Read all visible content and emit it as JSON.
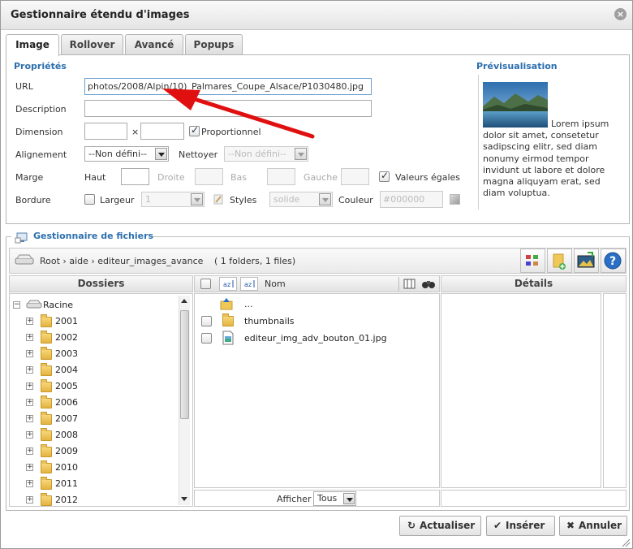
{
  "title": "Gestionnaire étendu d'images",
  "tabs": [
    "Image",
    "Rollover",
    "Avancé",
    "Popups"
  ],
  "props": {
    "section": "Propriétés",
    "url_label": "URL",
    "url_value": "photos/2008/Alpin/10)_Palmares_Coupe_Alsace/P1030480.jpg",
    "description_label": "Description",
    "dimension_label": "Dimension",
    "times": "×",
    "proportional_label": "Proportionnel",
    "alignment_label": "Alignement",
    "alignment_value": "--Non défini--",
    "clear_label": "Nettoyer",
    "clear_value": "--Non défini--",
    "margin_label": "Marge",
    "top_label": "Haut",
    "right_label": "Droite",
    "bottom_label": "Bas",
    "left_label": "Gauche",
    "equal_label": "Valeurs égales",
    "border_label": "Bordure",
    "width_label": "Largeur",
    "width_value": "1",
    "styles_label": "Styles",
    "styles_value": "solide",
    "color_label": "Couleur",
    "color_value": "#000000"
  },
  "preview": {
    "title": "Prévisualisation",
    "text": "Lorem ipsum dolor sit amet, consetetur sadipscing elitr, sed diam nonumy eirmod tempor invidunt ut labore et dolore magna aliquyam erat, sed diam voluptua."
  },
  "files": {
    "legend": "Gestionnaire de fichiers",
    "crumb_root": "Root",
    "crumb_1": "aide",
    "crumb_2": "editeur_images_avance",
    "sep": "›",
    "summary": "( 1 folders, 1 files)",
    "folders_header": "Dossiers",
    "details_header": "Détails",
    "name_col": "Nom",
    "root": "Racine",
    "years": [
      "2001",
      "2002",
      "2003",
      "2004",
      "2005",
      "2006",
      "2007",
      "2008",
      "2009",
      "2010",
      "2011",
      "2012"
    ],
    "up": "...",
    "items": [
      "thumbnails",
      "editeur_img_adv_bouton_01.jpg"
    ],
    "show_label": "Afficher",
    "show_value": "Tous"
  },
  "buttons": {
    "refresh": "Actualiser",
    "insert": "Insérer",
    "cancel": "Annuler"
  },
  "colors": {
    "section": "#2c6fae",
    "arrow": "#e01010"
  }
}
